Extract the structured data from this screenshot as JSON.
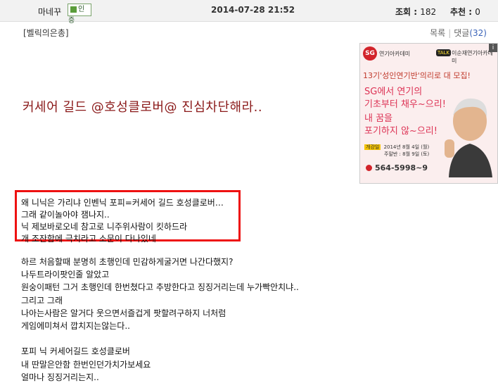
{
  "header": {
    "author": "마네꾸",
    "badge_label": "인증",
    "date": "2014-07-28 21:52",
    "views_label": "조회 : ",
    "views": "182",
    "recommend_label": "추천 : ",
    "recommend": "0"
  },
  "post": {
    "category": "[벨릭의은총]",
    "list_link": "목록",
    "comments_label": "댓글",
    "comments_count": "(32)",
    "title": "커세어 길드 @호성클로버@ 진심차단해라..",
    "highlighted_lines": [
      "왜 니닉은 가리냐 인벤닉 포피=커세어 길드 호성클로버…",
      "그래 같이놀아야 잼나지..",
      "닉 제보바로오네 참고로 니주위사람이 킷하드라",
      "개 조잔함에 극치라고 소문이 다나있네"
    ],
    "body_lines": [
      "하르 처음할때 분명히 초행인데 민감하게굴거면 나간다했지?",
      "나두트라이팟인줄 알았고",
      "원숭이패턴 그거 초행인데 한번쳤다고 추방한다고 징징거리는데 누가빡안치냐..",
      "그리고 그래",
      "나아는사람은 알거다 웃으면서즐겁게 팟할려구하지 너처럼",
      "게임에미쳐서 깝치지는않는다..",
      "",
      "포피 닉 커세어길드 호성클로버",
      "내 딴말은안함 한번인던가치가보세요",
      "얼마나 징징거리는지.."
    ]
  },
  "ad": {
    "logo": "SG",
    "academy": "연기아카데미",
    "talk": "TALK",
    "cafe": "이순재연기아카데미",
    "info": "i",
    "headline": "13기'성인연기반'의리로 대 모집!",
    "lines1": [
      "SG에서 연기의",
      "기초부터 채우~으리!"
    ],
    "lines2": [
      "내 꿈을",
      "포기하지 않~으리!"
    ],
    "open_label": "개강일",
    "open_dates": "2014년 8월 4일 (월)",
    "weekend_dates": "주말반 : 8월 9일 (토)",
    "phone": "564-5998~9",
    "accent": "#d2232a"
  }
}
